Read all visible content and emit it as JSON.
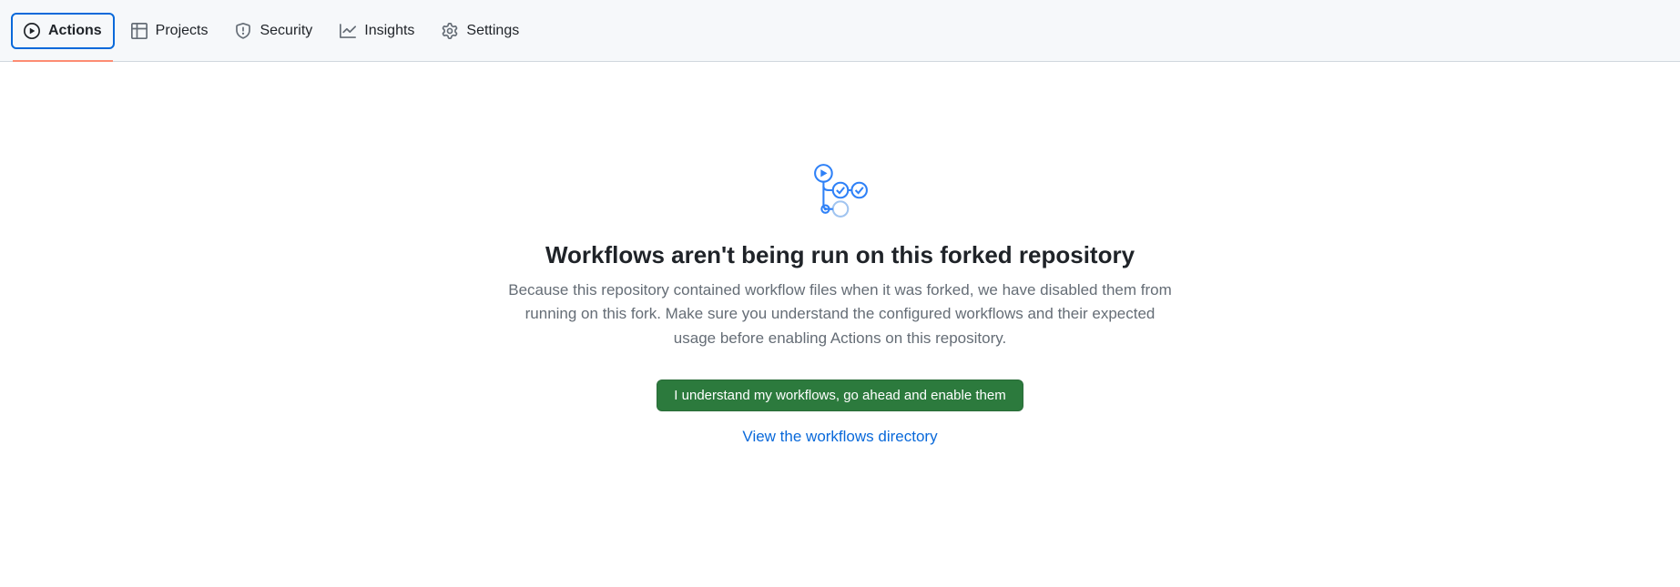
{
  "tabs": {
    "actions": "Actions",
    "projects": "Projects",
    "security": "Security",
    "insights": "Insights",
    "settings": "Settings"
  },
  "content": {
    "heading": "Workflows aren't being run on this forked repository",
    "description": "Because this repository contained workflow files when it was forked, we have disabled them from running on this fork. Make sure you understand the configured workflows and their expected usage before enabling Actions on this repository.",
    "enable_button": "I understand my workflows, go ahead and enable them",
    "view_link": "View the workflows directory"
  }
}
